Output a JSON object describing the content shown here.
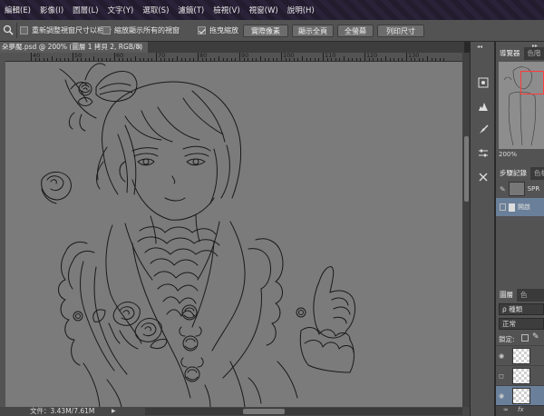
{
  "menu": [
    "編輯(E)",
    "影像(I)",
    "圖層(L)",
    "文字(Y)",
    "選取(S)",
    "濾鏡(T)",
    "檢視(V)",
    "視窗(W)",
    "說明(H)"
  ],
  "options": {
    "tool_icon": "zoom-icon",
    "resize_windows": "重新調整視窗尺寸以相合",
    "zoom_all": "縮放顯示所有的視窗",
    "scrubby_zoom": "拖曳縮放",
    "scrubby_checked": true,
    "btn_actual": "實際像素",
    "btn_fit": "顯示全頁",
    "btn_fill": "全螢幕",
    "btn_print": "列印尺寸"
  },
  "document": {
    "tab_title": "朵夢魘.psd @ 200% (圖層 1 拷貝 2, RGB/8)",
    "close": "×",
    "ruler_labels": [
      "40",
      "50",
      "60",
      "70",
      "80",
      "90",
      "100",
      "110",
      "120",
      "130"
    ],
    "status": "文件：3.43M/7.61M",
    "status_arrow": "▶"
  },
  "dock": {
    "collapse": "◂◂",
    "icons": [
      "navigator-icon",
      "histogram-icon",
      "brush-preset-icon",
      "adjust-icon",
      "tools-icon"
    ]
  },
  "panels": {
    "collapse": "▸▸",
    "navigator_tabs": [
      "導覽器",
      "色階"
    ],
    "zoom": "200%",
    "history_tabs": [
      "步驟記錄",
      "色板"
    ],
    "history_rows": [
      "SPR",
      "開啟"
    ],
    "layers_tabs": [
      "圖層",
      "色"
    ],
    "filter_label": "ρ 種類",
    "blend_mode": "正常",
    "lock_label": "鎖定:",
    "layer_names": [
      "",
      "",
      ""
    ],
    "footer": "fx"
  },
  "colors": {
    "accent_red": "#ff3b3b",
    "canvas_gray": "#7b7b7b",
    "line_dark": "#1a1a1a"
  }
}
